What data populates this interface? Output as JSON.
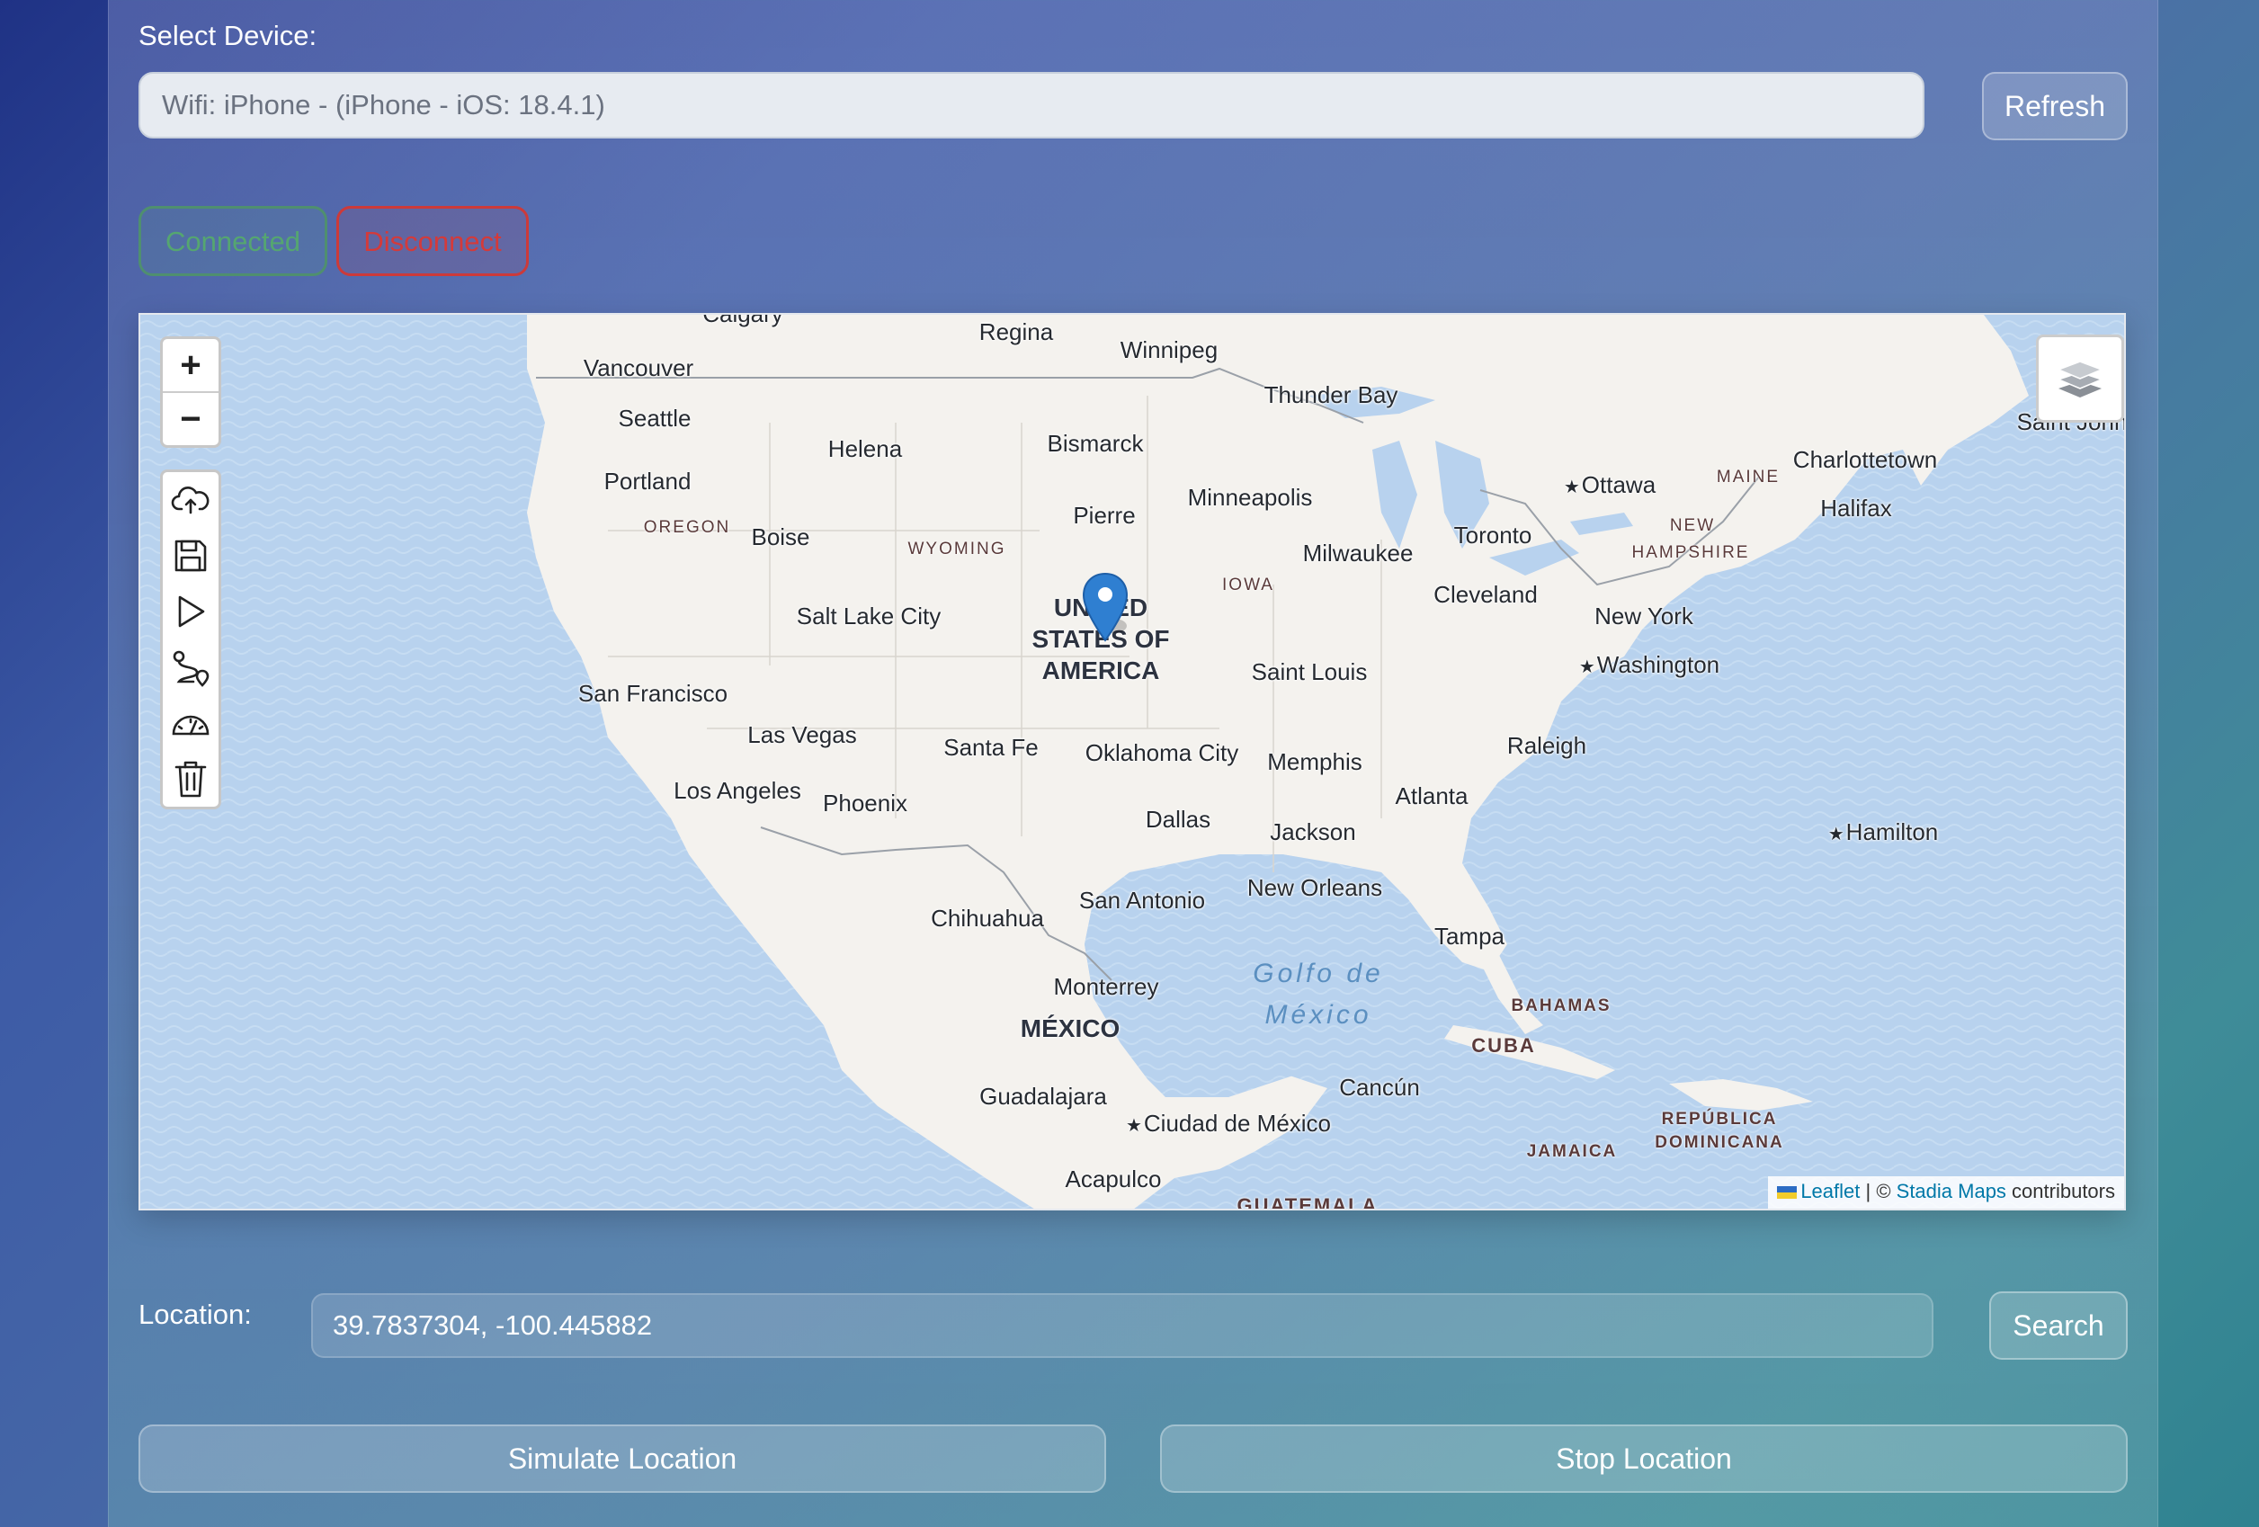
{
  "device": {
    "label": "Select Device:",
    "selected": "Wifi: iPhone - (iPhone - iOS: 18.4.1)",
    "refresh_label": "Refresh"
  },
  "connection": {
    "connected_label": "Connected",
    "disconnect_label": "Disconnect"
  },
  "map": {
    "zoom_in": "+",
    "zoom_out": "−",
    "tools": [
      "cloud-upload-icon",
      "save-icon",
      "play-icon",
      "route-icon",
      "speedometer-icon",
      "trash-icon"
    ],
    "layers_icon": "layers-icon",
    "cities": {
      "calgary": "Calgary",
      "regina": "Regina",
      "winnipeg": "Winnipeg",
      "vancouver": "Vancouver",
      "thunder_bay": "Thunder Bay",
      "saint_john": "Saint John",
      "seattle": "Seattle",
      "helena": "Helena",
      "bismarck": "Bismarck",
      "charlottetown": "Charlottetown",
      "ottawa": "Ottawa",
      "portland": "Portland",
      "minneapolis": "Minneapolis",
      "halifax": "Halifax",
      "pierre": "Pierre",
      "boise": "Boise",
      "toronto": "Toronto",
      "milwaukee": "Milwaukee",
      "cleveland": "Cleveland",
      "salt_lake_city": "Salt Lake City",
      "new_york": "New York",
      "washington": "Washington",
      "saint_louis": "Saint Louis",
      "san_francisco": "San Francisco",
      "las_vegas": "Las Vegas",
      "santa_fe": "Santa Fe",
      "oklahoma_city": "Oklahoma City",
      "raleigh": "Raleigh",
      "memphis": "Memphis",
      "los_angeles": "Los Angeles",
      "phoenix": "Phoenix",
      "atlanta": "Atlanta",
      "dallas": "Dallas",
      "jackson": "Jackson",
      "hamilton": "Hamilton",
      "new_orleans": "New Orleans",
      "san_antonio": "San Antonio",
      "chihuahua": "Chihuahua",
      "tampa": "Tampa",
      "monterrey": "Monterrey",
      "cancun": "Cancún",
      "guadalajara": "Guadalajara",
      "ciudad_de_mexico": "Ciudad de México",
      "acapulco": "Acapulco"
    },
    "states": {
      "oregon": "OREGON",
      "wyoming": "WYOMING",
      "iowa": "IOWA",
      "maine": "MAINE",
      "new_hampshire_1": "NEW",
      "new_hampshire_2": "HAMPSHIRE",
      "bahamas": "BAHAMAS",
      "cuba": "CUBA",
      "jamaica": "JAMAICA",
      "dominicana_1": "REPÚBLICA",
      "dominicana_2": "DOMINICANA",
      "guatemala": "GUATEMALA"
    },
    "countries": {
      "usa_1": "UNITED",
      "usa_2": "STATES OF",
      "usa_3": "AMERICA",
      "mexico": "MÉXICO"
    },
    "seas": {
      "golfo_1": "Golfo de",
      "golfo_2": "México"
    },
    "attribution": {
      "leaflet": "Leaflet",
      "separator": " | © ",
      "stadia": "Stadia Maps",
      "suffix": " contributors"
    },
    "colors": {
      "water": "#b8d2ee",
      "land": "#f4f2ee",
      "marker": "#2f7fd1"
    }
  },
  "location": {
    "label": "Location:",
    "value": "39.7837304, -100.445882",
    "search_label": "Search"
  },
  "actions": {
    "simulate_label": "Simulate Location",
    "stop_label": "Stop Location"
  }
}
